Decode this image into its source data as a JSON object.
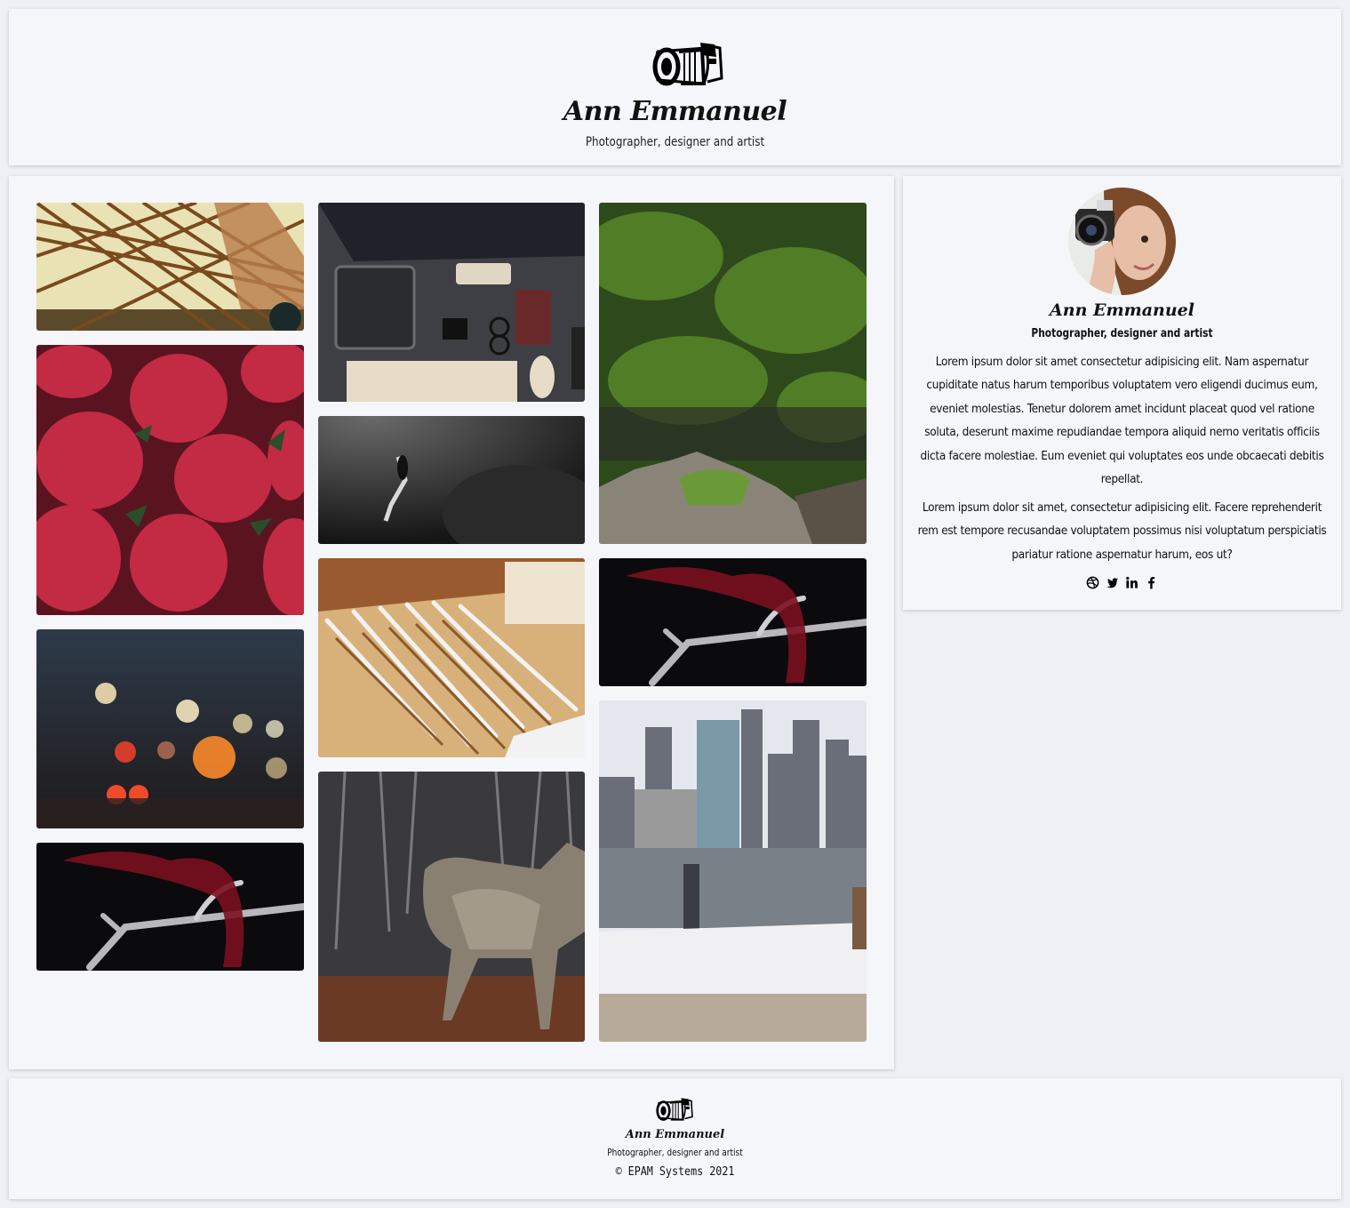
{
  "header": {
    "name": "Ann Emmanuel",
    "tagline": "Photographer, designer and artist",
    "logo_icon": "camera-icon"
  },
  "gallery": {
    "photos": [
      {
        "name": "bridge-photo",
        "subject": "steel bridge"
      },
      {
        "name": "strawberries-photo",
        "subject": "strawberries"
      },
      {
        "name": "bokeh-lights-photo",
        "subject": "city lights bokeh"
      },
      {
        "name": "antler-photo",
        "subject": "antler with red ribbon"
      },
      {
        "name": "desk-workspace-photo",
        "subject": "desk with keyboard and tablet"
      },
      {
        "name": "diver-photo",
        "subject": "underwater diver"
      },
      {
        "name": "pencils-photo",
        "subject": "pencils and rulers"
      },
      {
        "name": "wolf-photo",
        "subject": "wolf in forest"
      },
      {
        "name": "mossy-rocks-photo",
        "subject": "moss covered rocks"
      },
      {
        "name": "antler-photo-2",
        "subject": "antler with red ribbon"
      },
      {
        "name": "city-skyline-photo",
        "subject": "city skyline over river"
      }
    ]
  },
  "profile": {
    "name": "Ann Emmanuel",
    "tagline": "Photographer, designer and artist",
    "bio_1": "Lorem ipsum dolor sit amet consectetur adipisicing elit. Nam aspernatur cupiditate natus harum temporibus voluptatem vero eligendi ducimus eum, eveniet molestias. Tenetur dolorem amet incidunt placeat quod vel ratione soluta, deserunt maxime repudiandae tempora aliquid nemo veritatis officiis dicta facere molestiae. Eum eveniet qui voluptates eos unde obcaecati debitis repellat.",
    "bio_2": "Lorem ipsum dolor sit amet, consectetur adipisicing elit. Facere reprehenderit rem est tempore recusandae voluptatem possimus nisi voluptatum perspiciatis pariatur ratione aspernatur harum, eos ut?",
    "social": [
      "dribbble-icon",
      "twitter-icon",
      "linkedin-icon",
      "facebook-icon"
    ]
  },
  "footer": {
    "name": "Ann Emmanuel",
    "tagline": "Photographer, designer and artist",
    "copyright": "© EPAM Systems 2021"
  }
}
